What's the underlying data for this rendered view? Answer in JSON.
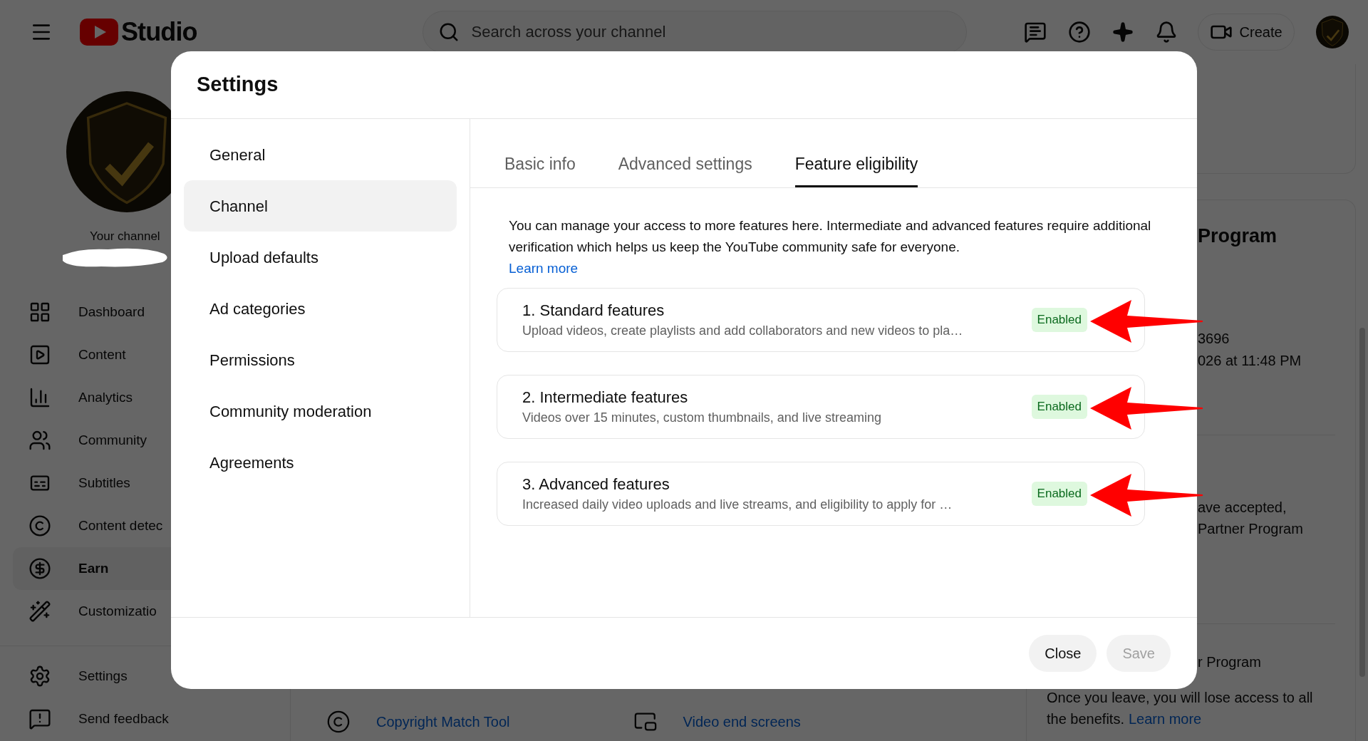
{
  "header": {
    "app_name": "Studio",
    "search": {
      "placeholder": "Search across your channel"
    },
    "create_button": "Create"
  },
  "sidebar": {
    "channel_label": "Your channel",
    "items": [
      {
        "label": "Dashboard",
        "selected": false
      },
      {
        "label": "Content",
        "selected": false
      },
      {
        "label": "Analytics",
        "selected": false
      },
      {
        "label": "Community",
        "selected": false
      },
      {
        "label": "Subtitles",
        "selected": false
      },
      {
        "label": "Content detec",
        "selected": false
      },
      {
        "label": "Earn",
        "selected": true
      },
      {
        "label": "Customizatio",
        "selected": false
      }
    ],
    "footer_items": [
      "Settings",
      "Send feedback"
    ]
  },
  "main": {
    "bottom_links": [
      "Copyright Match Tool",
      "Video end screens"
    ],
    "right_panel": {
      "heading": "Program",
      "lines": [
        "3696",
        "026 at 11:48 PM"
      ],
      "lines_2": [
        "ave accepted,",
        "Partner Program"
      ],
      "subheading": "r Program",
      "note_lines": [
        "Once you leave, you will lose access to all",
        "the benefits."
      ],
      "note_link": "Learn more"
    }
  },
  "dialog": {
    "title": "Settings",
    "nav": [
      {
        "label": "General",
        "selected": false
      },
      {
        "label": "Channel",
        "selected": true
      },
      {
        "label": "Upload defaults",
        "selected": false
      },
      {
        "label": "Ad categories",
        "selected": false
      },
      {
        "label": "Permissions",
        "selected": false
      },
      {
        "label": "Community moderation",
        "selected": false
      },
      {
        "label": "Agreements",
        "selected": false
      }
    ],
    "tabs": [
      {
        "label": "Basic info",
        "selected": false
      },
      {
        "label": "Advanced settings",
        "selected": false
      },
      {
        "label": "Feature eligibility",
        "selected": true
      }
    ],
    "intro": "You can manage your access to more features here. Intermediate and advanced features require additional verification which helps us keep the YouTube community safe for everyone.",
    "learn_more": "Learn more",
    "features": [
      {
        "title": "1. Standard features",
        "description": "Upload videos, create playlists and add collaborators and new videos to pla…",
        "status": "Enabled"
      },
      {
        "title": "2. Intermediate features",
        "description": "Videos over 15 minutes, custom thumbnails, and live streaming",
        "status": "Enabled"
      },
      {
        "title": "3. Advanced features",
        "description": "Increased daily video uploads and live streams, and eligibility to apply for …",
        "status": "Enabled"
      }
    ],
    "buttons": [
      {
        "label": "Close",
        "disabled": false
      },
      {
        "label": "Save",
        "disabled": true
      }
    ]
  }
}
